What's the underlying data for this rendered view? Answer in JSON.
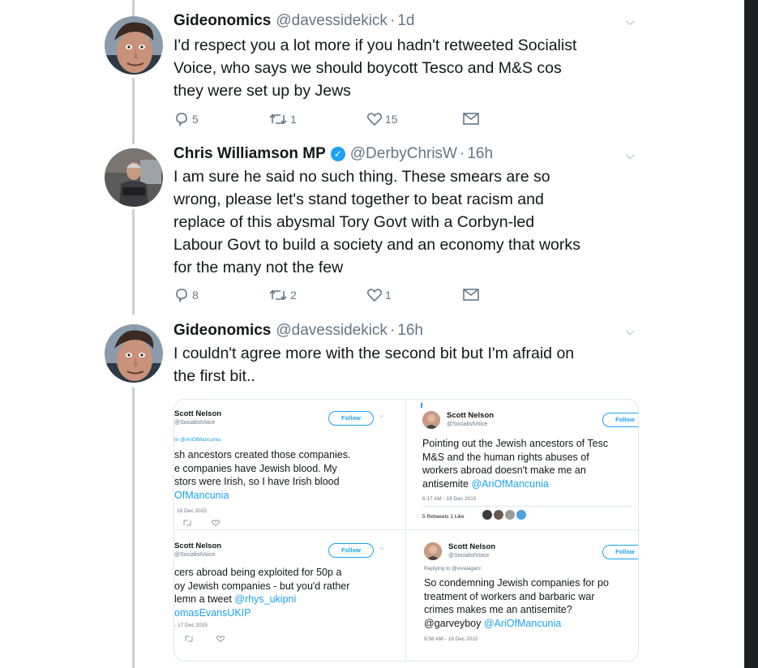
{
  "tweets": [
    {
      "name": "Gideonomics",
      "handle": "@davessidekick",
      "time": "1d",
      "text_lines": [
        "I'd respect you a lot more if you hadn't retweeted Socialist",
        "Voice, who says we should boycott Tesco and M&S cos",
        "they were set up by Jews"
      ],
      "replies": "5",
      "retweets": "1",
      "likes": "15"
    },
    {
      "name": "Chris Williamson MP",
      "verified_glyph": "✓",
      "handle": "@DerbyChrisW",
      "time": "16h",
      "text_lines": [
        "I am sure he said no such thing. These smears are so",
        "wrong, please let's stand together to beat racism and",
        "replace of this abysmal Tory Govt with a Corbyn-led",
        "Labour Govt to build a society and an economy that works",
        "for the many not the few"
      ],
      "replies": "8",
      "retweets": "2",
      "likes": "1"
    },
    {
      "name": "Gideonomics",
      "handle": "@davessidekick",
      "time": "16h",
      "text_lines": [
        "I couldn't agree more with the second bit but I'm afraid on",
        "the first bit.."
      ]
    }
  ],
  "separator_dot": "·",
  "chevron_glyph": "⌵",
  "icons": {
    "reply": "reply-icon",
    "retweet": "retweet-icon",
    "like": "heart-icon",
    "message": "envelope-icon"
  },
  "media": {
    "top_left": {
      "name": "Scott Nelson",
      "handle": "@SocialistVoice",
      "follow": "Follow",
      "replying": "to @AriOfMancunia",
      "lines": [
        "sh ancestors created those companies.",
        "e companies have Jewish blood. My",
        "stors were Irish, so I have Irish blood"
      ],
      "mention_line": "OfMancunia",
      "date": "18 Dec 2015"
    },
    "top_right": {
      "name": "Scott Nelson",
      "handle": "@SocialistVoice",
      "follow": "Follow",
      "lines": [
        "Pointing out the Jewish ancestors of Tesc",
        "M&S and the human rights abuses of",
        "workers abroad doesn't make me an"
      ],
      "last_line_text": "antisemite ",
      "last_line_mention": "@AriOfMancunia",
      "date": "6:17 AM - 18 Dec 2015",
      "counts": "5 Retweets   1 Like"
    },
    "bottom_left": {
      "name": "Scott Nelson",
      "handle": "@SocialistVoice",
      "follow": "Follow",
      "lines": [
        "cers abroad being exploited for 50p a",
        "oy Jewish companies - but you'd rather"
      ],
      "line3_text": "lemn a tweet ",
      "line3_mention": "@rhys_ukipni",
      "mention_line": "omasEvansUKIP",
      "date": "- 17 Dec 2015"
    },
    "bottom_right": {
      "name": "Scott Nelson",
      "handle": "@SocialistVoice",
      "follow": "Follow",
      "replying": "Replying to @vivaiagarv",
      "lines": [
        "So condemning Jewish companies for po",
        "treatment of workers and barbaric war",
        "crimes makes me an antisemite?"
      ],
      "last_line_text": "@garveyboy ",
      "last_line_mention": "@AriOfMancunia",
      "date": "9:58 AM - 18 Dec 2015"
    }
  },
  "colors": {
    "accent": "#1da1f2",
    "text": "#14171a",
    "secondary": "#657786",
    "thread_line": "#c6d0d6"
  }
}
